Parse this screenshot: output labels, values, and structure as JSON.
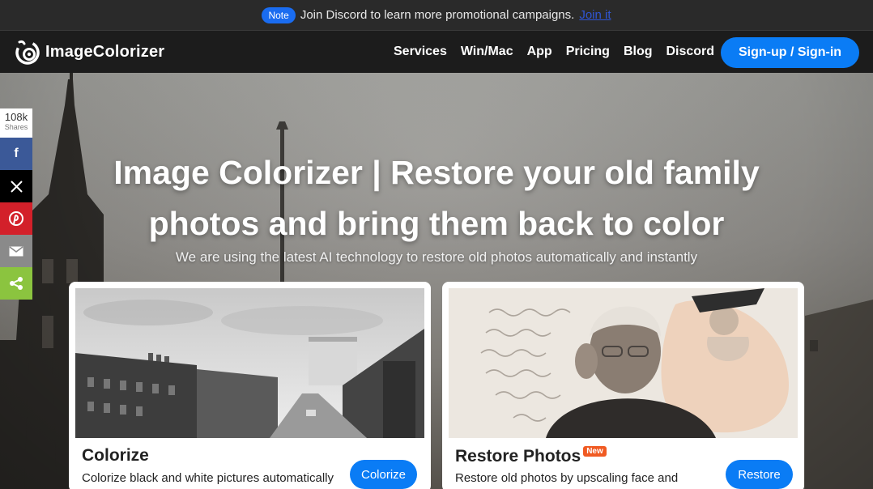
{
  "notice": {
    "badge": "Note",
    "text": "Join Discord to learn more promotional campaigns.",
    "link": "Join it"
  },
  "nav": {
    "logo_text": "ImageColorizer",
    "items": [
      "Services",
      "Win/Mac",
      "App",
      "Pricing",
      "Blog",
      "Discord"
    ],
    "signin_label": "Sign-up / Sign-in"
  },
  "hero": {
    "headline": "Image Colorizer | Restore your old family photos and bring them back to color",
    "subline": "We are using the latest AI technology to restore old photos automatically and instantly"
  },
  "share": {
    "count": "108k",
    "count_label": "Shares",
    "buttons": [
      "facebook-icon",
      "x-icon",
      "pinterest-icon",
      "email-icon",
      "share-icon"
    ]
  },
  "cards": [
    {
      "title": "Colorize",
      "badge": "",
      "description": "Colorize black and white pictures automatically",
      "button": "Colorize"
    },
    {
      "title": "Restore Photos",
      "badge": "New",
      "description": "Restore old photos by upscaling face and",
      "button": "Restore"
    }
  ],
  "colors": {
    "accent": "#0a7cf5",
    "nav_bg": "#1c1c1c",
    "new_badge": "#f05a22"
  }
}
